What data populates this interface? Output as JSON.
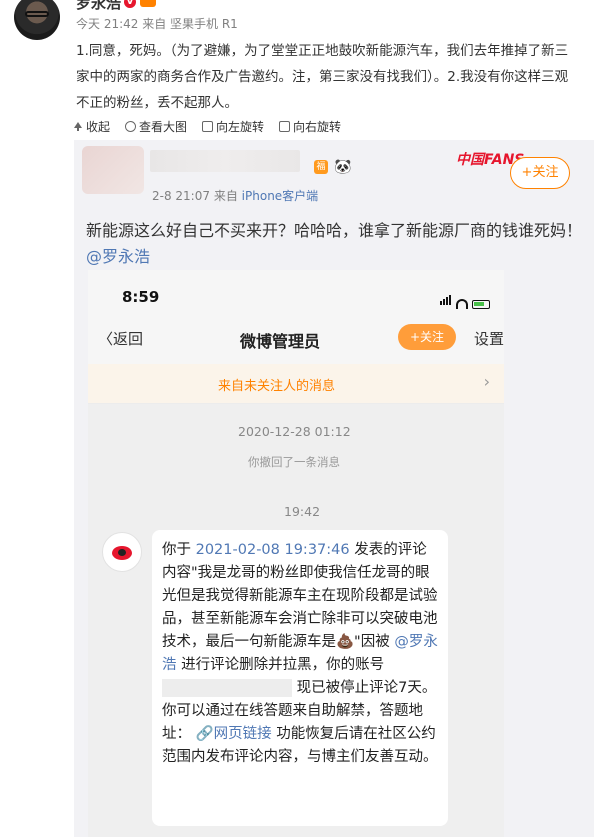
{
  "post": {
    "username": "罗永浩",
    "meta": "今天 21:42 来自 坚果手机 R1",
    "text": "1.同意，死妈。（为了避嫌，为了堂堂正正地鼓吹新能源汽车，我们去年推掉了新三家中的两家的商务合作及广告邀约。注，第三家没有找我们）。2.我没有你这样三观不正的粉丝，丢不起那人。"
  },
  "actions": [
    {
      "label": "收起",
      "icon": "collapse-icon"
    },
    {
      "label": "查看大图",
      "icon": "zoom-icon"
    },
    {
      "label": "向左旋转",
      "icon": "rotate-left-icon"
    },
    {
      "label": "向右旋转",
      "icon": "rotate-right-icon"
    }
  ],
  "repost": {
    "meta_time": "2-8 21:07",
    "meta_from": "来自",
    "meta_source": "iPhone客户端",
    "follow_label": "+关注",
    "fans_logo": "中国FANS",
    "text_main": "新能源这么好自己不买来开？哈哈哈，谁拿了新能源厂商的钱谁死妈！",
    "text_at": "@罗永浩"
  },
  "phone": {
    "time": "8:59",
    "back": "返回",
    "title": "微博管理员",
    "follow": "+关注",
    "settings": "设置",
    "banner": "来自未关注人的消息",
    "date": "2020-12-28 01:12",
    "withdrawn": "你撤回了一条消息",
    "time2": "19:42",
    "msg_prefix": "你于",
    "msg_date": "2021-02-08 19:37:46",
    "msg_part1": "发表的评论内容\"我是龙哥的粉丝即使我信任龙哥的眼光但是我觉得新能源车主在现阶段都是试验品，甚至新能源车会消亡除非可以突破电池技术，最后一句新能源车是💩\"因被",
    "msg_at": "@罗永浩",
    "msg_part2": "进行评论删除并拉黑，你的账号",
    "msg_part3": "现已被停止评论7天。你可以通过在线答题来自助解禁，答题地址：",
    "msg_link": "🔗网页链接",
    "msg_part4": "功能恢复后请在社区公约范围内发布评论内容，与博主们友善互动。"
  }
}
